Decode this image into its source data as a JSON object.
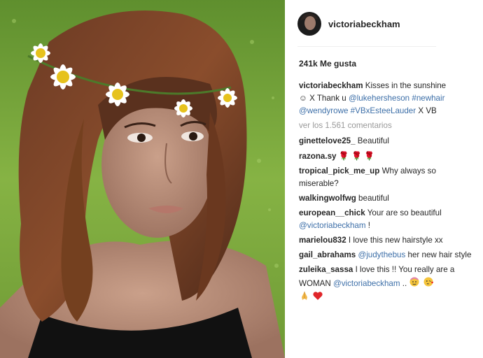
{
  "post": {
    "username": "victoriabeckham",
    "likes": "241k Me gusta",
    "caption": {
      "user": "victoriabeckham",
      "text_1": "Kisses in the sunshine",
      "emoji_1": "☺",
      "text_2": "X Thank u",
      "mention_1": "@lukehersheson",
      "hashtag_1": "#newhair",
      "mention_2": "@wendyrowe",
      "hashtag_2": "#VBxEsteeLauder",
      "text_3": "X VB"
    },
    "view_comments": "ver los 1.561 comentarios",
    "comments": [
      {
        "user": "ginettelove25_",
        "text": "Beautiful"
      },
      {
        "user": "razona.sy",
        "roses": "🌹 🌹 🌹"
      },
      {
        "user": "tropical_pick_me_up",
        "text": "Why always so miserable?"
      },
      {
        "user": "walkingwolfwg",
        "text": "beautiful"
      },
      {
        "user": "european__chick",
        "text": "Your are so beautiful",
        "mention": "@victoriabeckham",
        "tail": "!"
      },
      {
        "user": "marielou832",
        "text": "I love this new hairstyle xx"
      },
      {
        "user": "gail_abrahams",
        "mention": "@judythebus",
        "text": "her new hair style"
      },
      {
        "user": "zuleika_sassa",
        "text": "I love this !! You really are a WOMAN",
        "mention": "@victoriabeckham",
        "tail": ".."
      }
    ]
  },
  "colors": {
    "link": "#3d6fa8",
    "muted": "#999999",
    "text": "#262626",
    "rose": "#d2232a"
  }
}
